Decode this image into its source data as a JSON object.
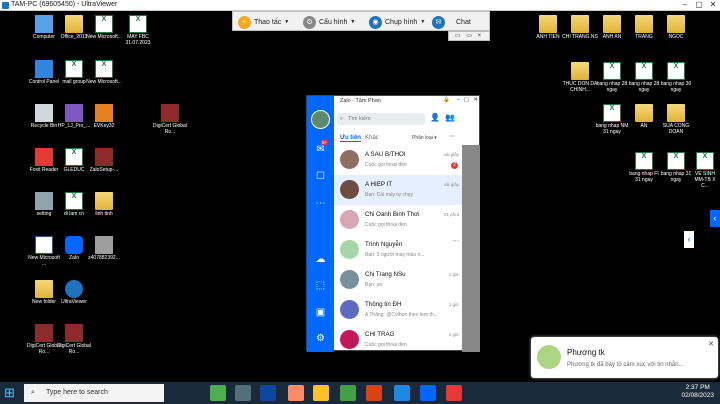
{
  "window": {
    "title": "TAM-PC (69605450) - UltraViewer"
  },
  "toolbar": {
    "items": [
      {
        "label": "Thao tác"
      },
      {
        "label": "Cấu hình"
      },
      {
        "label": "Chụp hình"
      },
      {
        "label": "Chat"
      }
    ],
    "sub": "▭ ▭ ×"
  },
  "desktop_left": [
    {
      "label": "Computer"
    },
    {
      "label": "Office_2019"
    },
    {
      "label": "New Microsoft..."
    },
    {
      "label": "MAY FBC 31.07.2023"
    },
    {
      "label": "Control Panel"
    },
    {
      "label": "mail group"
    },
    {
      "label": "New Microsoft..."
    },
    {
      "label": "Recycle Bin"
    },
    {
      "label": "HP_LJ_Pro_..."
    },
    {
      "label": "EVKey32"
    },
    {
      "label": "DigiCert Global Ro..."
    },
    {
      "label": "Foxit Reader"
    },
    {
      "label": "GLEDUC"
    },
    {
      "label": "ZaloSetup-..."
    },
    {
      "label": "setting"
    },
    {
      "label": "di lam cn"
    },
    {
      "label": "linh tinh"
    },
    {
      "label": "New Microsoft ..."
    },
    {
      "label": "Zalo"
    },
    {
      "label": "z407882392..."
    },
    {
      "label": "New folder"
    },
    {
      "label": "UltraViewer"
    },
    {
      "label": "DigiCert Global Ro..."
    },
    {
      "label": "DigiCert Global Ro..."
    }
  ],
  "desktop_right": [
    {
      "label": "ANH TIEN"
    },
    {
      "label": "CHI TRANG NS"
    },
    {
      "label": "ANH AN"
    },
    {
      "label": "TRANG"
    },
    {
      "label": "NGOC"
    },
    {
      "label": "THUC DON DA CHINH..."
    },
    {
      "label": "bang nhap 28 ngay"
    },
    {
      "label": "bang nhap 28 ngay"
    },
    {
      "label": "bang nhap 30 ngay"
    },
    {
      "label": "bang nhap NM 31 ngay"
    },
    {
      "label": "AN"
    },
    {
      "label": "SUA CONG DOAN"
    },
    {
      "label": "bang nhap FI 31 ngay"
    },
    {
      "label": "bang nhap 31 ngay"
    },
    {
      "label": "VE SINH MM-TB X C..."
    }
  ],
  "zalo": {
    "header": "Zalo - Tâm Phan",
    "search_placeholder": "Tìm kiếm",
    "badge": "5+",
    "tabs": [
      "Ưu tiên",
      "Khác"
    ],
    "filter": "Phân loại",
    "chats": [
      {
        "name": "A SAU B/THOI",
        "msg": "Cuộc gọi thoại đến",
        "time": "vài giây",
        "badge": "2"
      },
      {
        "name": "A HIEP IT",
        "msg": "Bạn: Cái máy tự chạy",
        "time": "vài giây",
        "badge": ""
      },
      {
        "name": "Chi Oanh Binh Thơi",
        "msg": "Cuộc gọi thoại đến",
        "time": "21 phút",
        "badge": ""
      },
      {
        "name": "Trình Nguyễn",
        "msg": "Bạn: 3 người may mẫu n...",
        "time": "",
        "badge": ""
      },
      {
        "name": "Chi Trang NSu",
        "msg": "Bạn: ya",
        "time": "1 giờ",
        "badge": ""
      },
      {
        "name": "Thông tin ĐH",
        "msg": "A Thắng: @Cvthon theo tem th...",
        "time": "1 giờ",
        "badge": ""
      },
      {
        "name": "CHI TRAG",
        "msg": "Cuộc gọi thoại đến",
        "time": "1 giờ",
        "badge": ""
      }
    ]
  },
  "notification": {
    "name": "Phương tk",
    "msg": "Phương tk đã bày tỏ cảm xúc với tin nhắn..."
  },
  "taskbar": {
    "search": "Type here to search",
    "time": "2:37 PM",
    "date": "02/08/2023"
  },
  "colors": {
    "accent": "#0068ff",
    "taskbar": "#1b2a3a"
  }
}
